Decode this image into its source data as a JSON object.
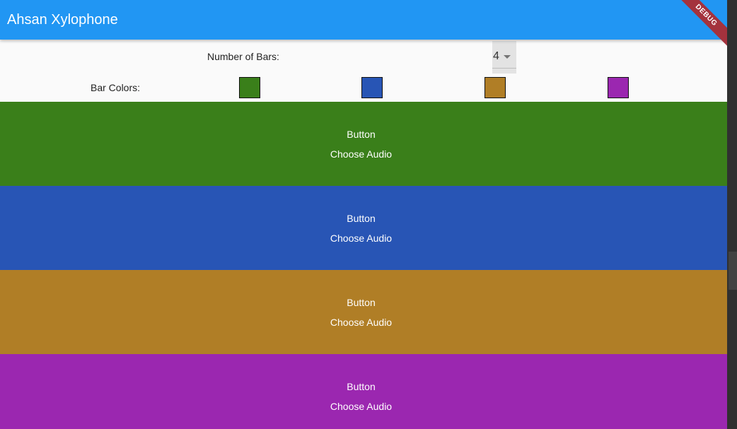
{
  "app": {
    "title": "Ahsan Xylophone",
    "debug_label": "DEBUG"
  },
  "settings": {
    "count_label": "Number of Bars:",
    "count_value": "4",
    "colors_label": "Bar Colors:",
    "colors": [
      "#3a7f1a",
      "#2855b5",
      "#b07e26",
      "#9b27b0"
    ]
  },
  "bars": [
    {
      "title": "Button",
      "audio_label": "Choose Audio",
      "color": "#3a7f1a"
    },
    {
      "title": "Button",
      "audio_label": "Choose Audio",
      "color": "#2855b5"
    },
    {
      "title": "Button",
      "audio_label": "Choose Audio",
      "color": "#b07e26"
    },
    {
      "title": "Button",
      "audio_label": "Choose Audio",
      "color": "#9b27b0"
    }
  ]
}
